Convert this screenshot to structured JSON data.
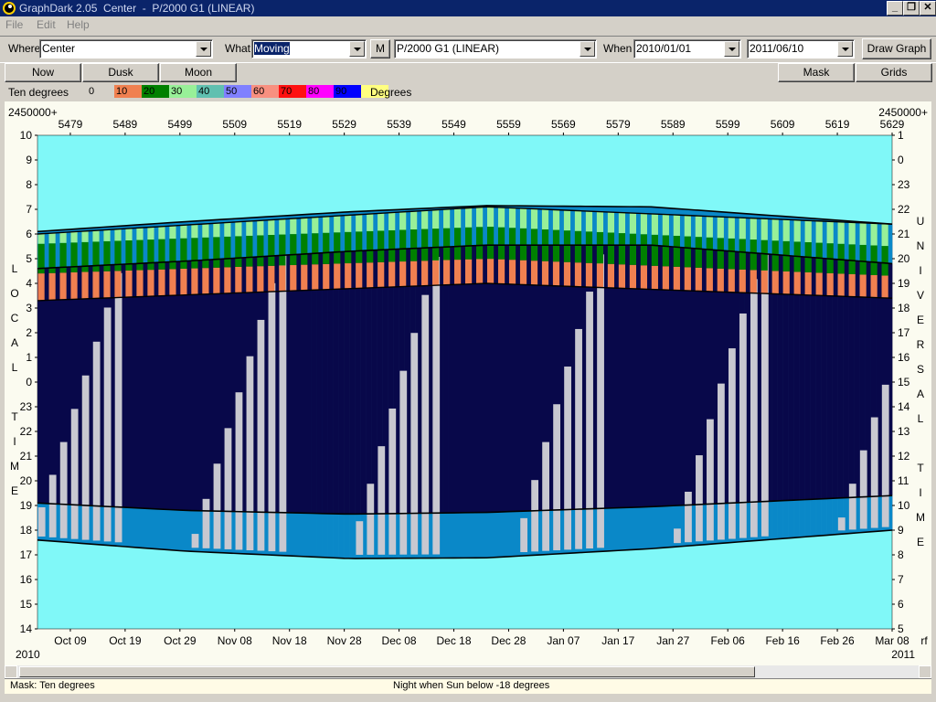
{
  "window": {
    "title": "GraphDark 2.05  Center  -  P/2000 G1 (LINEAR)",
    "minimize": "_",
    "restore": "❐",
    "close": "✕"
  },
  "menu": [
    "File",
    "Edit",
    "Help"
  ],
  "toolbar": {
    "where_label": "Where",
    "where_value": "Center",
    "what_label": "What",
    "what_value": "Moving",
    "m_button": "M",
    "object_value": "P/2000 G1 (LINEAR)",
    "when_label": "When",
    "start_date": "2010/01/01",
    "end_date": "2011/06/10",
    "draw_graph": "Draw Graph"
  },
  "buttons": {
    "now": "Now",
    "dusk": "Dusk",
    "moon": "Moon",
    "mask": "Mask",
    "grids": "Grids"
  },
  "legend": {
    "title": "Ten degrees",
    "unit": "Degrees",
    "entries": [
      {
        "label": "0",
        "color": "#d4d0c8"
      },
      {
        "label": "10",
        "color": "#f08050"
      },
      {
        "label": "20",
        "color": "#008000"
      },
      {
        "label": "30",
        "color": "#98f098"
      },
      {
        "label": "40",
        "color": "#60c0b0"
      },
      {
        "label": "50",
        "color": "#8080ff"
      },
      {
        "label": "60",
        "color": "#f89080"
      },
      {
        "label": "70",
        "color": "#ff1010"
      },
      {
        "label": "80",
        "color": "#ff00ff"
      },
      {
        "label": "90",
        "color": "#0000ff"
      },
      {
        "label": "",
        "color": "#ffff80"
      }
    ]
  },
  "status": {
    "mask": "Mask:  Ten degrees",
    "night": "Night when Sun below -18 degrees"
  },
  "chart_data": {
    "type": "heatmap",
    "top_axis_prefix_left": "2450000+",
    "top_axis_prefix_right": "2450000+",
    "jd_ticks": [
      "5479",
      "5489",
      "5499",
      "5509",
      "5519",
      "5529",
      "5539",
      "5549",
      "5559",
      "5569",
      "5579",
      "5589",
      "5599",
      "5609",
      "5619",
      "5629"
    ],
    "date_ticks": [
      "Oct 09",
      "Oct 19",
      "Oct 29",
      "Nov 08",
      "Nov 18",
      "Nov 28",
      "Dec 08",
      "Dec 18",
      "Dec 28",
      "Jan 07",
      "Jan 17",
      "Jan 27",
      "Feb 06",
      "Feb 16",
      "Feb 26",
      "Mar 08"
    ],
    "year_left": "2010",
    "year_right": "2011",
    "x_range_jd": [
      5473,
      5629
    ],
    "left_ticks": [
      "10",
      "9",
      "8",
      "7",
      "6",
      "5",
      "4",
      "3",
      "2",
      "1",
      "0",
      "23",
      "22",
      "21",
      "20",
      "19",
      "18",
      "17",
      "16",
      "15",
      "14"
    ],
    "right_ticks": [
      "1",
      "0",
      "23",
      "22",
      "21",
      "20",
      "19",
      "18",
      "17",
      "16",
      "15",
      "14",
      "13",
      "12",
      "11",
      "10",
      "9",
      "8",
      "7",
      "6",
      "5"
    ],
    "left_label": "LOCAL TIME",
    "right_label": "UNIVERSAL TIME",
    "right_corner_label": "rf",
    "y_range_local_hours": [
      14,
      34
    ],
    "twilight": {
      "sunset": [
        [
          5473,
          17.6
        ],
        [
          5500,
          17.15
        ],
        [
          5530,
          16.85
        ],
        [
          5555,
          16.88
        ],
        [
          5585,
          17.25
        ],
        [
          5629,
          18.0
        ]
      ],
      "dusk_end": [
        [
          5473,
          19.1
        ],
        [
          5500,
          18.8
        ],
        [
          5530,
          18.65
        ],
        [
          5555,
          18.72
        ],
        [
          5585,
          18.95
        ],
        [
          5629,
          19.4
        ]
      ],
      "dawn_start": [
        [
          5473,
          28.6
        ],
        [
          5500,
          28.9
        ],
        [
          5530,
          29.3
        ],
        [
          5555,
          29.55
        ],
        [
          5585,
          29.55
        ],
        [
          5629,
          28.8
        ]
      ],
      "sunrise": [
        [
          5473,
          30.1
        ],
        [
          5500,
          30.5
        ],
        [
          5530,
          30.9
        ],
        [
          5555,
          31.15
        ],
        [
          5585,
          31.1
        ],
        [
          5629,
          30.4
        ]
      ]
    },
    "altitude_bands": [
      {
        "name": "10",
        "upper": [
          [
            5473,
            28.4
          ],
          [
            5555,
            29.0
          ],
          [
            5629,
            28.3
          ]
        ],
        "lower": [
          [
            5473,
            27.3
          ],
          [
            5555,
            28.0
          ],
          [
            5629,
            27.4
          ]
        ]
      },
      {
        "name": "20",
        "upper": [
          [
            5473,
            29.6
          ],
          [
            5555,
            30.3
          ],
          [
            5629,
            29.5
          ]
        ],
        "lower": [
          [
            5473,
            28.4
          ],
          [
            5555,
            29.0
          ],
          [
            5629,
            28.3
          ]
        ]
      },
      {
        "name": "30",
        "upper": [
          [
            5473,
            30.0
          ],
          [
            5555,
            31.1
          ],
          [
            5629,
            30.4
          ]
        ],
        "lower": [
          [
            5473,
            29.6
          ],
          [
            5555,
            30.3
          ],
          [
            5629,
            29.5
          ]
        ]
      }
    ],
    "moonlight_start_jd": [
      5471,
      5500,
      5529,
      5559,
      5588,
      5618
    ],
    "moonlight_period_days": 29.5
  }
}
